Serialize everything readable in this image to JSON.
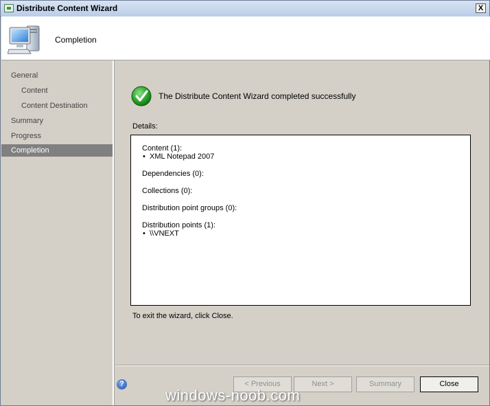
{
  "window": {
    "title": "Distribute Content Wizard",
    "close_label": "X"
  },
  "header": {
    "title": "Completion",
    "icon": "computer-icon"
  },
  "sidebar": {
    "items": [
      {
        "label": "General",
        "indent": false,
        "selected": false
      },
      {
        "label": "Content",
        "indent": true,
        "selected": false
      },
      {
        "label": "Content Destination",
        "indent": true,
        "selected": false
      },
      {
        "label": "Summary",
        "indent": false,
        "selected": false
      },
      {
        "label": "Progress",
        "indent": false,
        "selected": false
      },
      {
        "label": "Completion",
        "indent": false,
        "selected": true
      }
    ]
  },
  "main": {
    "status_icon": "success-checkmark-icon",
    "status_message": "The Distribute Content Wizard completed successfully",
    "details_label": "Details:",
    "details": {
      "content_heading": "Content (1):",
      "content_item": "XML Notepad 2007",
      "dependencies_heading": "Dependencies (0):",
      "collections_heading": "Collections (0):",
      "dp_groups_heading": "Distribution point groups (0):",
      "dp_heading": "Distribution points (1):",
      "dp_item": "\\\\VNEXT"
    },
    "exit_text": "To exit the wizard, click Close."
  },
  "footer": {
    "help_icon": "help-icon",
    "previous_label": "< Previous",
    "next_label": "Next >",
    "summary_label": "Summary",
    "close_label": "Close"
  },
  "watermark": "windows-noob.com"
}
